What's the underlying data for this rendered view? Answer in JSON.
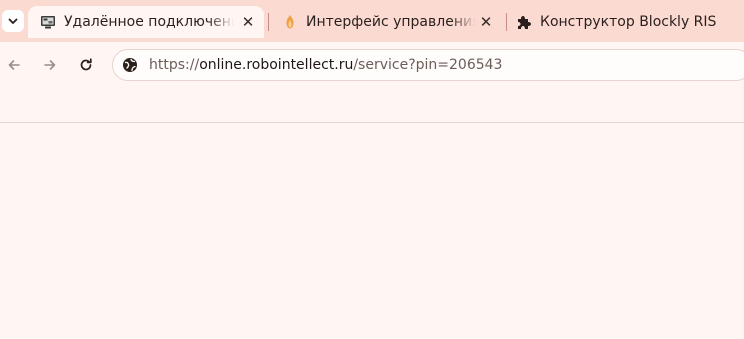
{
  "colors": {
    "tabstrip_bg": "#fbdad2",
    "page_bg": "#fff5f2",
    "text": "#2a1f1c",
    "url_muted": "#6b5c58"
  },
  "tabs": [
    {
      "title": "Удалённое подключение",
      "icon": "remote-desktop-icon",
      "active": true
    },
    {
      "title": "Интерфейс управления",
      "icon": "robot-flame-icon",
      "active": false
    },
    {
      "title": "Конструктор Blockly RIS",
      "icon": "puzzle-piece-icon",
      "active": false
    }
  ],
  "toolbar": {
    "back_icon": "arrow-left-icon",
    "forward_icon": "arrow-right-icon",
    "reload_icon": "reload-icon",
    "site_info_icon": "globe-icon"
  },
  "omnibox": {
    "url_scheme": "https://",
    "url_host": "online.robointellect.ru",
    "url_path": "/service?pin=206543"
  }
}
